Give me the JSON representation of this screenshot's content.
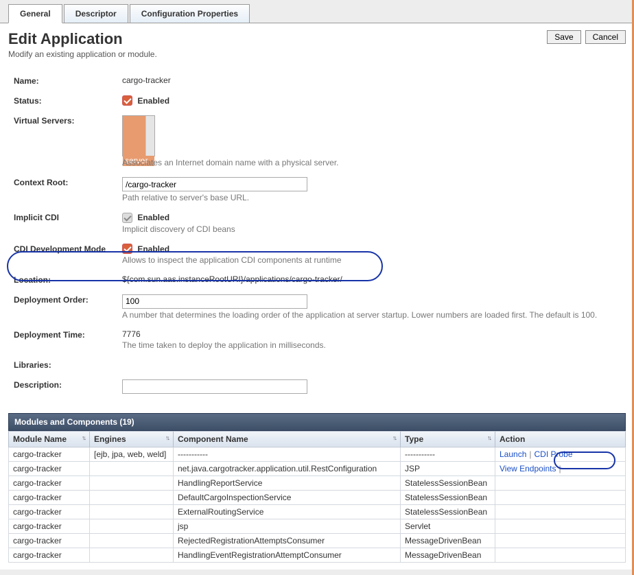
{
  "tabs": {
    "general": "General",
    "descriptor": "Descriptor",
    "config": "Configuration Properties"
  },
  "page": {
    "title": "Edit Application",
    "subtitle": "Modify an existing application or module."
  },
  "buttons": {
    "save": "Save",
    "cancel": "Cancel"
  },
  "form": {
    "name_label": "Name:",
    "name_value": "cargo-tracker",
    "status_label": "Status:",
    "status_enabled": "Enabled",
    "virtual_servers_label": "Virtual Servers:",
    "virtual_servers_option": "server",
    "virtual_servers_help": "Associates an Internet domain name with a physical server.",
    "context_root_label": "Context Root:",
    "context_root_value": "/cargo-tracker",
    "context_root_help": "Path relative to server's base URL.",
    "implicit_cdi_label": "Implicit CDI",
    "implicit_cdi_enabled": "Enabled",
    "implicit_cdi_help": "Implicit discovery of CDI beans",
    "cdi_dev_label": "CDI Development Mode",
    "cdi_dev_enabled": "Enabled",
    "cdi_dev_help": "Allows to inspect the application CDI components at runtime",
    "location_label": "Location:",
    "location_value": "${com.sun.aas.instanceRootURI}/applications/cargo-tracker/",
    "deploy_order_label": "Deployment Order:",
    "deploy_order_value": "100",
    "deploy_order_help": "A number that determines the loading order of the application at server startup. Lower numbers are loaded first. The default is 100.",
    "deploy_time_label": "Deployment Time:",
    "deploy_time_value": "7776",
    "deploy_time_help": "The time taken to deploy the application in milliseconds.",
    "libraries_label": "Libraries:",
    "description_label": "Description:",
    "description_value": ""
  },
  "table": {
    "title": "Modules and Components (19)",
    "headers": {
      "module": "Module Name",
      "engines": "Engines",
      "component": "Component Name",
      "type": "Type",
      "action": "Action"
    },
    "actions": {
      "launch": "Launch",
      "cdi_probe": "CDI Probe",
      "view_endpoints": "View Endpoints"
    },
    "rows": [
      {
        "module": "cargo-tracker",
        "engines": "[ejb, jpa, web, weld]",
        "component": "-----------",
        "type": "-----------",
        "action": "launch_probe"
      },
      {
        "module": "cargo-tracker",
        "engines": "",
        "component": "net.java.cargotracker.application.util.RestConfiguration",
        "type": "JSP",
        "action": "endpoints"
      },
      {
        "module": "cargo-tracker",
        "engines": "",
        "component": "HandlingReportService",
        "type": "StatelessSessionBean",
        "action": ""
      },
      {
        "module": "cargo-tracker",
        "engines": "",
        "component": "DefaultCargoInspectionService",
        "type": "StatelessSessionBean",
        "action": ""
      },
      {
        "module": "cargo-tracker",
        "engines": "",
        "component": "ExternalRoutingService",
        "type": "StatelessSessionBean",
        "action": ""
      },
      {
        "module": "cargo-tracker",
        "engines": "",
        "component": "jsp",
        "type": "Servlet",
        "action": ""
      },
      {
        "module": "cargo-tracker",
        "engines": "",
        "component": "RejectedRegistrationAttemptsConsumer",
        "type": "MessageDrivenBean",
        "action": ""
      },
      {
        "module": "cargo-tracker",
        "engines": "",
        "component": "HandlingEventRegistrationAttemptConsumer",
        "type": "MessageDrivenBean",
        "action": ""
      }
    ]
  }
}
